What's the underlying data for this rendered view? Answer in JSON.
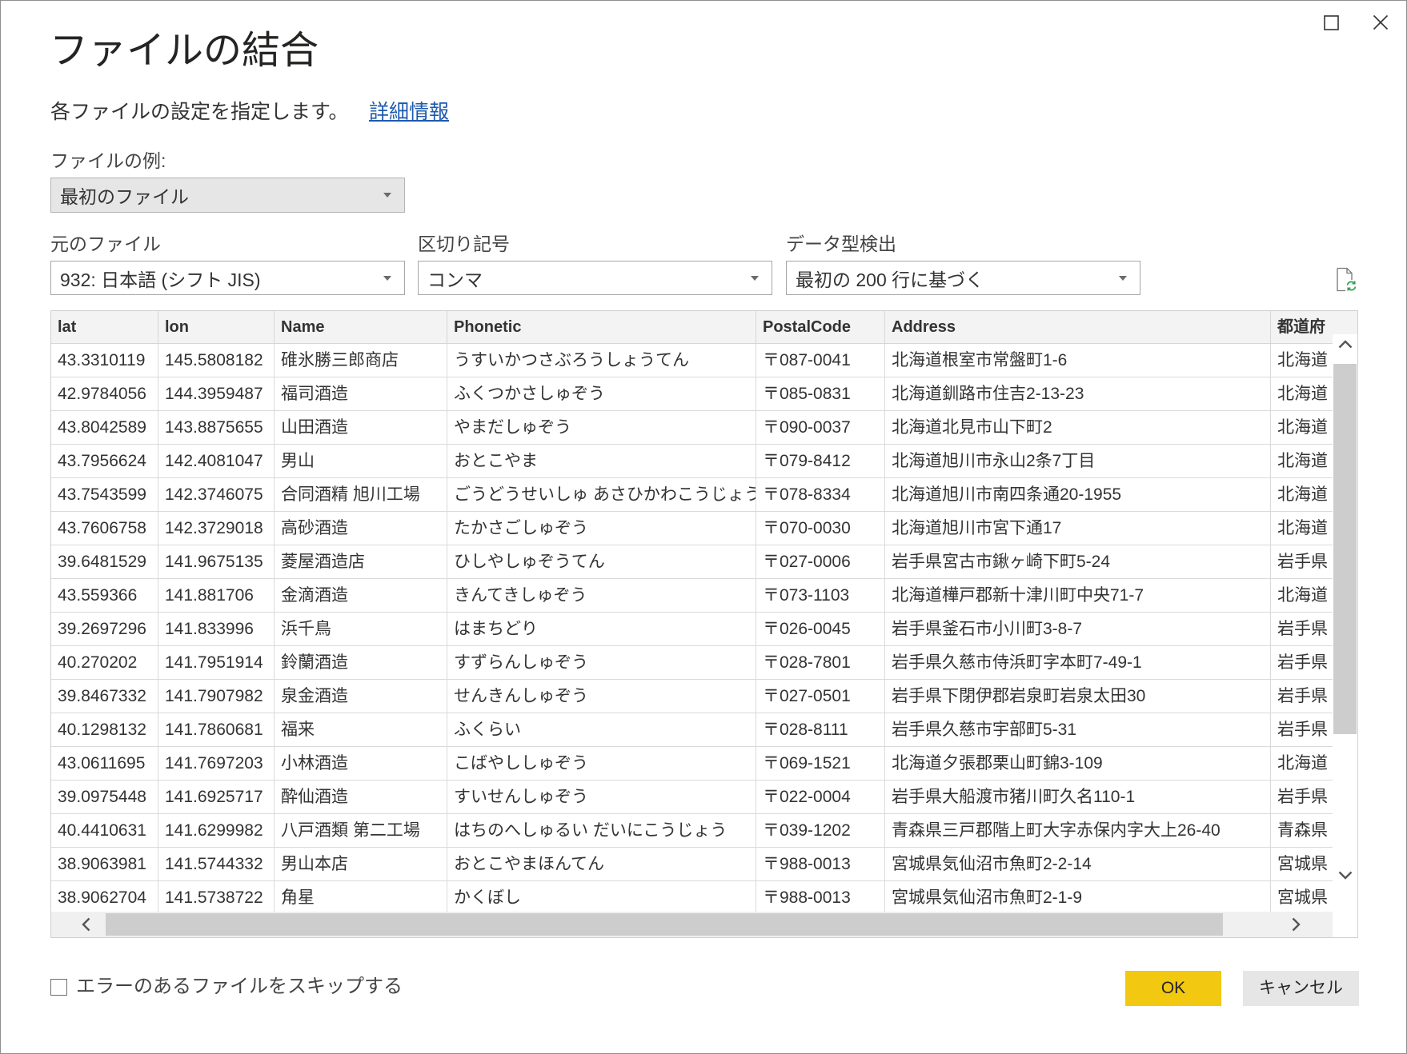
{
  "header": {
    "title": "ファイルの結合",
    "description": "各ファイルの設定を指定します。",
    "learn_more": "詳細情報"
  },
  "example_file": {
    "label": "ファイルの例:",
    "value": "最初のファイル"
  },
  "settings": {
    "origin": {
      "label": "元のファイル",
      "value": "932: 日本語 (シフト JIS)"
    },
    "delimiter": {
      "label": "区切り記号",
      "value": "コンマ"
    },
    "type_detection": {
      "label": "データ型検出",
      "value": "最初の 200 行に基づく"
    }
  },
  "table": {
    "columns": [
      "lat",
      "lon",
      "Name",
      "Phonetic",
      "PostalCode",
      "Address",
      "都道府"
    ],
    "rows": [
      [
        "43.3310119",
        "145.5808182",
        "碓氷勝三郎商店",
        "うすいかつさぶろうしょうてん",
        "〒087-0041",
        "北海道根室市常盤町1-6",
        "北海道"
      ],
      [
        "42.9784056",
        "144.3959487",
        "福司酒造",
        "ふくつかさしゅぞう",
        "〒085-0831",
        "北海道釧路市住吉2-13-23",
        "北海道"
      ],
      [
        "43.8042589",
        "143.8875655",
        "山田酒造",
        "やまだしゅぞう",
        "〒090-0037",
        "北海道北見市山下町2",
        "北海道"
      ],
      [
        "43.7956624",
        "142.4081047",
        "男山",
        "おとこやま",
        "〒079-8412",
        "北海道旭川市永山2条7丁目",
        "北海道"
      ],
      [
        "43.7543599",
        "142.3746075",
        "合同酒精 旭川工場",
        "ごうどうせいしゅ あさひかわこうじょう",
        "〒078-8334",
        "北海道旭川市南四条通20-1955",
        "北海道"
      ],
      [
        "43.7606758",
        "142.3729018",
        "高砂酒造",
        "たかさごしゅぞう",
        "〒070-0030",
        "北海道旭川市宮下通17",
        "北海道"
      ],
      [
        "39.6481529",
        "141.9675135",
        "菱屋酒造店",
        "ひしやしゅぞうてん",
        "〒027-0006",
        "岩手県宮古市鍬ヶ崎下町5-24",
        "岩手県"
      ],
      [
        "43.559366",
        "141.881706",
        "金滴酒造",
        "きんてきしゅぞう",
        "〒073-1103",
        "北海道樺戸郡新十津川町中央71-7",
        "北海道"
      ],
      [
        "39.2697296",
        "141.833996",
        "浜千鳥",
        "はまちどり",
        "〒026-0045",
        "岩手県釜石市小川町3-8-7",
        "岩手県"
      ],
      [
        "40.270202",
        "141.7951914",
        "鈴蘭酒造",
        "すずらんしゅぞう",
        "〒028-7801",
        "岩手県久慈市侍浜町字本町7-49-1",
        "岩手県"
      ],
      [
        "39.8467332",
        "141.7907982",
        "泉金酒造",
        "せんきんしゅぞう",
        "〒027-0501",
        "岩手県下閉伊郡岩泉町岩泉太田30",
        "岩手県"
      ],
      [
        "40.1298132",
        "141.7860681",
        "福来",
        "ふくらい",
        "〒028-8111",
        "岩手県久慈市宇部町5-31",
        "岩手県"
      ],
      [
        "43.0611695",
        "141.7697203",
        "小林酒造",
        "こばやししゅぞう",
        "〒069-1521",
        "北海道夕張郡栗山町錦3-109",
        "北海道"
      ],
      [
        "39.0975448",
        "141.6925717",
        "酔仙酒造",
        "すいせんしゅぞう",
        "〒022-0004",
        "岩手県大船渡市猪川町久名110-1",
        "岩手県"
      ],
      [
        "40.4410631",
        "141.6299982",
        "八戸酒類 第二工場",
        "はちのへしゅるい だいにこうじょう",
        "〒039-1202",
        "青森県三戸郡階上町大字赤保内字大上26-40",
        "青森県"
      ],
      [
        "38.9063981",
        "141.5744332",
        "男山本店",
        "おとこやまほんてん",
        "〒988-0013",
        "宮城県気仙沼市魚町2-2-14",
        "宮城県"
      ],
      [
        "38.9062704",
        "141.5738722",
        "角星",
        "かくぼし",
        "〒988-0013",
        "宮城県気仙沼市魚町2-1-9",
        "宮城県"
      ]
    ]
  },
  "footer": {
    "skip_errors_label": "エラーのあるファイルをスキップする",
    "skip_errors_checked": false,
    "ok_label": "OK",
    "cancel_label": "キャンセル"
  },
  "icons": {
    "maximize": "maximize-icon",
    "close": "close-icon",
    "dropdown": "chevron-down-icon",
    "refresh": "refresh-icon",
    "scroll_up": "chevron-up-icon",
    "scroll_down": "chevron-down-icon",
    "scroll_left": "chevron-left-icon",
    "scroll_right": "chevron-right-icon"
  },
  "colors": {
    "ok_button": "#F2C811",
    "cancel_button": "#E6E6E6",
    "link": "#1E5AAE",
    "header_background": "#F3F3F3",
    "refresh_accent": "#2E9E4F"
  }
}
